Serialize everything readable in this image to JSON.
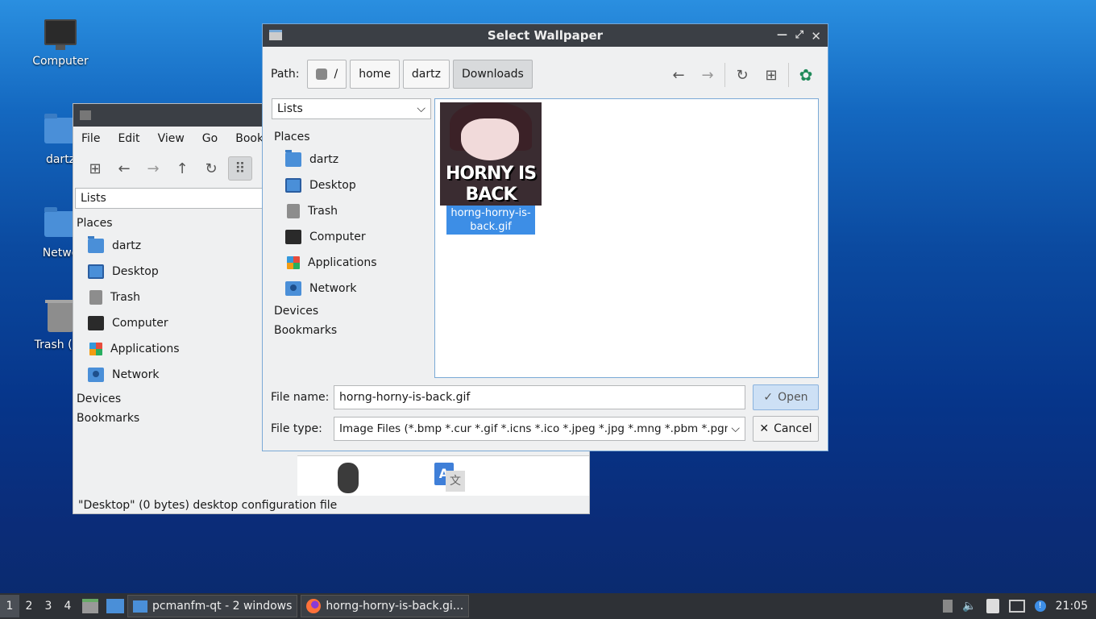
{
  "desktop": {
    "icons": [
      {
        "label": "Computer"
      },
      {
        "label": "dartz"
      },
      {
        "label": "Netwo"
      },
      {
        "label": "Trash (En"
      }
    ]
  },
  "file_manager": {
    "menu": [
      "File",
      "Edit",
      "View",
      "Go",
      "Bookı"
    ],
    "view_combo": "Lists",
    "places_header": "Places",
    "places": [
      "dartz",
      "Desktop",
      "Trash",
      "Computer",
      "Applications",
      "Network"
    ],
    "devices_header": "Devices",
    "bookmarks_header": "Bookmarks",
    "status": "\"Desktop\" (0 bytes) desktop configuration file"
  },
  "dialog": {
    "title": "Select Wallpaper",
    "path_label": "Path:",
    "crumbs": [
      "/",
      "home",
      "dartz",
      "Downloads"
    ],
    "view_combo": "Lists",
    "places_header": "Places",
    "places": [
      "dartz",
      "Desktop",
      "Trash",
      "Computer",
      "Applications",
      "Network"
    ],
    "devices_header": "Devices",
    "bookmarks_header": "Bookmarks",
    "file": {
      "name": "horng-horny-is-back.gif",
      "thumb_text": "HORNY IS BACK"
    },
    "filename_label": "File name:",
    "filename_value": "horng-horny-is-back.gif",
    "filetype_label": "File type:",
    "filetype_value": "Image Files (*.bmp *.cur *.gif *.icns *.ico *.jpeg *.jpg *.mng *.pbm *.pgm",
    "open_label": "Open",
    "cancel_label": "Cancel"
  },
  "taskbar": {
    "workspaces": [
      "1",
      "2",
      "3",
      "4"
    ],
    "tasks": [
      "pcmanfm-qt - 2 windows",
      "horng-horny-is-back.gi..."
    ],
    "clock": "21:05"
  }
}
